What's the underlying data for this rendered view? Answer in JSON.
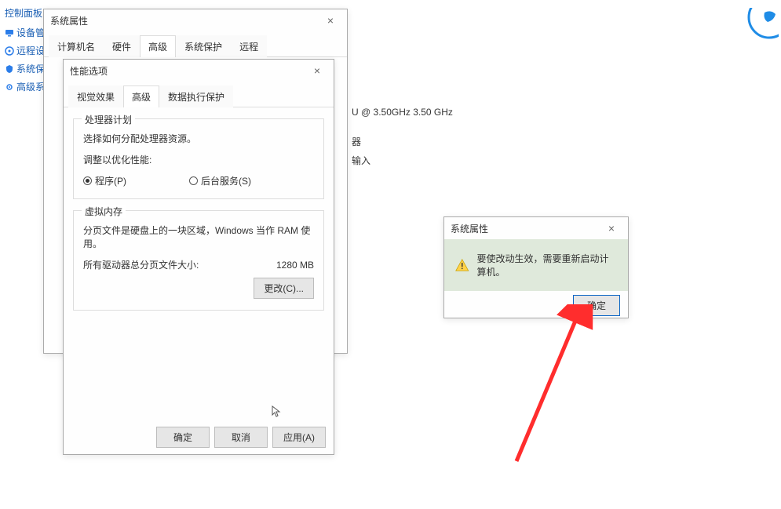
{
  "sidebar": {
    "title": "控制面板",
    "items": [
      {
        "label": "设备管理"
      },
      {
        "label": "远程设置"
      },
      {
        "label": "系统保护"
      },
      {
        "label": "高级系统"
      }
    ]
  },
  "background": {
    "cpu_line": "U @ 3.50GHz  3.50 GHz",
    "line2": "器",
    "line3": "输入"
  },
  "sysprops": {
    "title": "系统属性",
    "tabs": [
      "计算机名",
      "硬件",
      "高级",
      "系统保护",
      "远程"
    ],
    "active_tab_index": 2
  },
  "perf": {
    "title": "性能选项",
    "tabs": [
      "视觉效果",
      "高级",
      "数据执行保护"
    ],
    "active_tab_index": 1,
    "scheduling": {
      "legend": "处理器计划",
      "desc": "选择如何分配处理器资源。",
      "adjust_label": "调整以优化性能:",
      "opt_programs": "程序(P)",
      "opt_bg": "后台服务(S)"
    },
    "vm": {
      "legend": "虚拟内存",
      "desc": "分页文件是硬盘上的一块区域，Windows 当作 RAM 使用。",
      "total_label": "所有驱动器总分页文件大小:",
      "total_value": "1280 MB",
      "change_btn": "更改(C)..."
    },
    "buttons": {
      "ok": "确定",
      "cancel": "取消",
      "apply": "应用(A)"
    }
  },
  "msgbox": {
    "title": "系统属性",
    "text": "要使改动生效，需要重新启动计算机。",
    "ok": "确定"
  },
  "icons": {
    "device": "device-icon",
    "remote": "remote-icon",
    "shield": "shield-icon",
    "gear": "gear-icon"
  }
}
